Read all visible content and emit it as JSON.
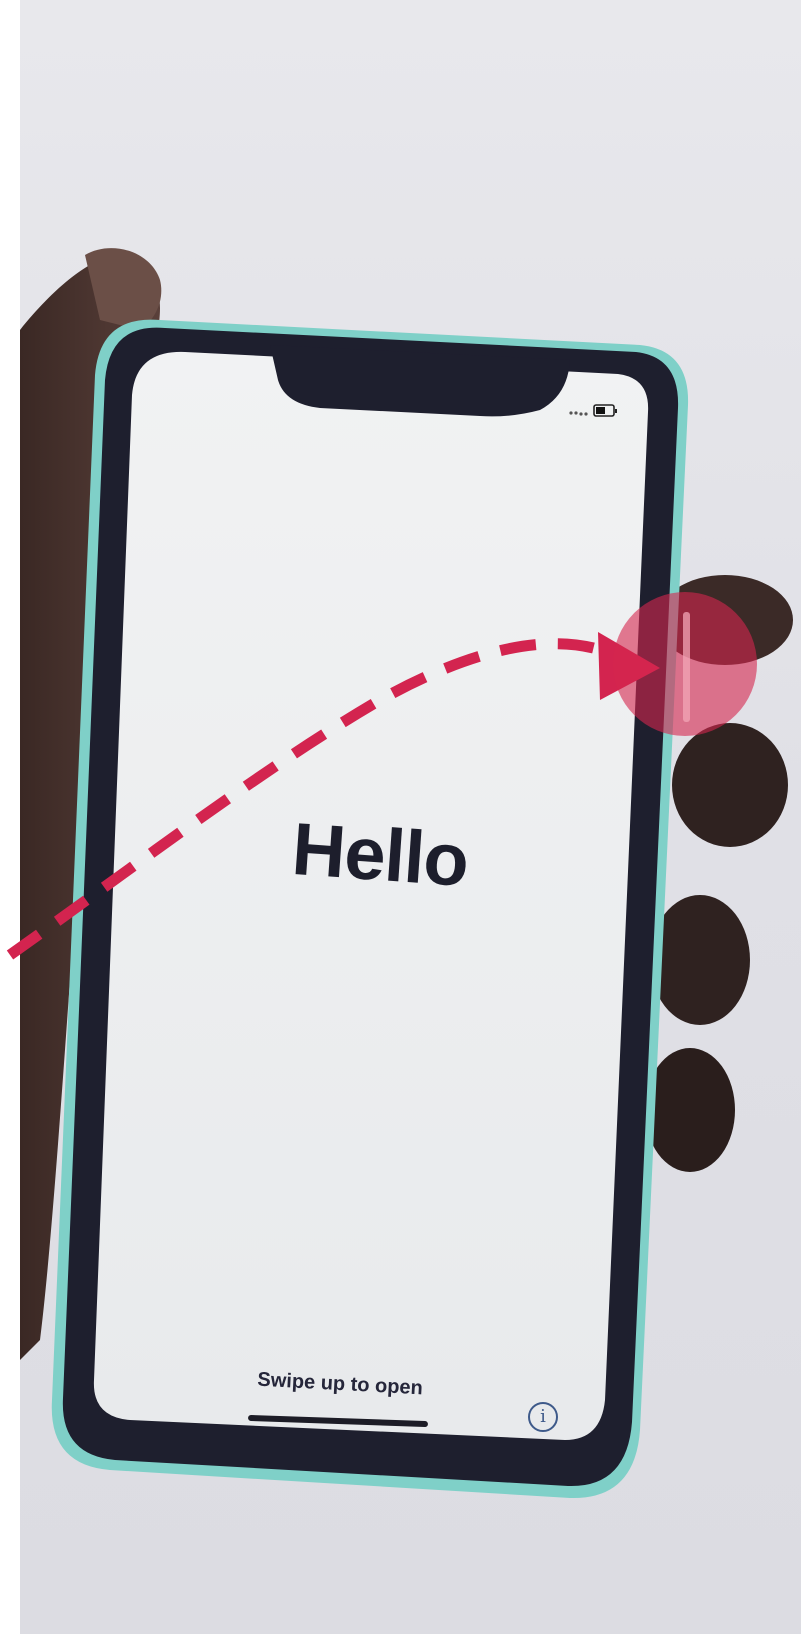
{
  "screen": {
    "greeting": "Hello",
    "swipe_hint": "Swipe up to open",
    "info_icon": "info-circle-icon",
    "status_icons": [
      "signal-dots-icon",
      "battery-icon"
    ]
  },
  "annotation": {
    "type": "dashed-curved-arrow",
    "target": "side-button",
    "color": "#d6264f",
    "highlight_color": "#d6264f"
  },
  "colors": {
    "screen": "#eceef0",
    "bezel": "#1e1f2e",
    "frame": "#78c9c4",
    "background": "#e2e2e8"
  }
}
